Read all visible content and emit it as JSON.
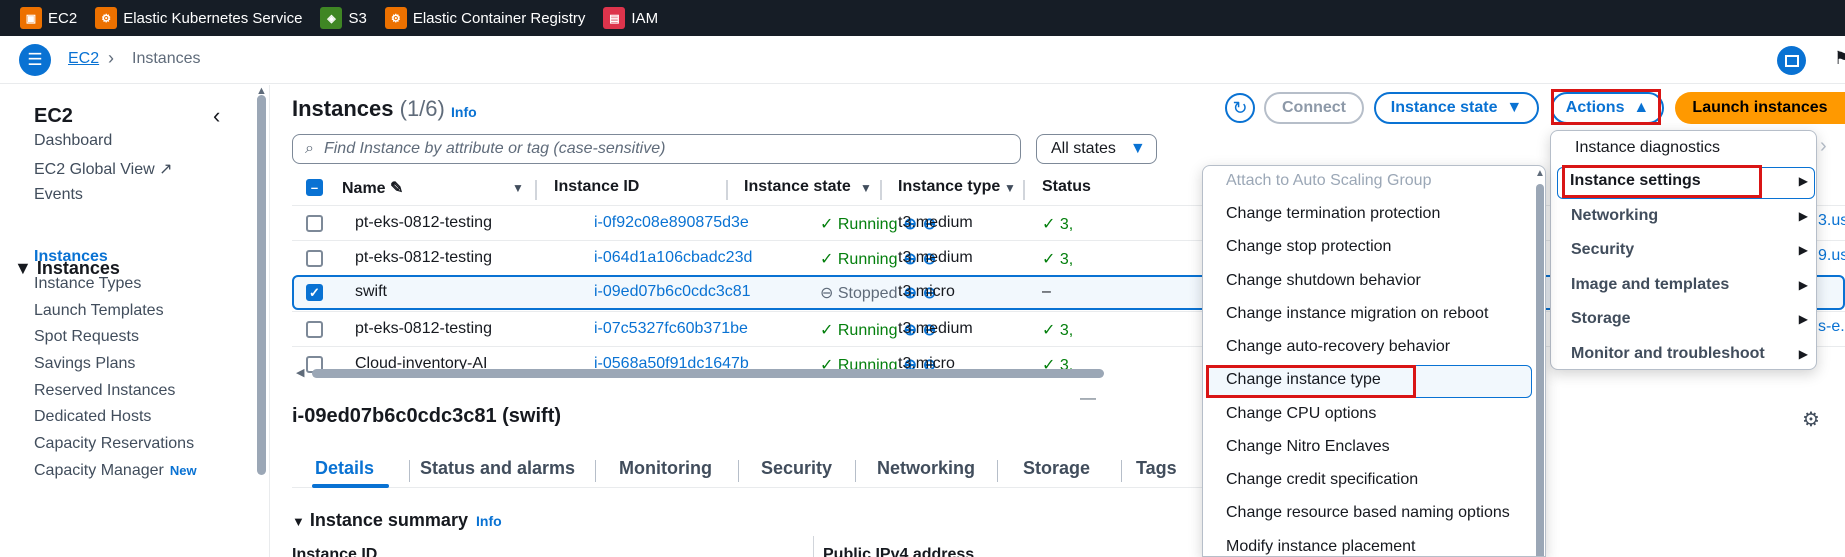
{
  "services": [
    {
      "label": "EC2",
      "icon": "ec2-icon",
      "color": "#ed7100"
    },
    {
      "label": "Elastic Kubernetes Service",
      "icon": "eks-icon",
      "color": "#ed7100"
    },
    {
      "label": "S3",
      "icon": "s3-icon",
      "color": "#3f8624"
    },
    {
      "label": "Elastic Container Registry",
      "icon": "ecr-icon",
      "color": "#ed7100"
    },
    {
      "label": "IAM",
      "icon": "iam-icon",
      "color": "#dd344c"
    }
  ],
  "breadcrumb": {
    "service": "EC2",
    "separator": "›",
    "current": "Instances"
  },
  "sidebar": {
    "title": "EC2",
    "items_top": [
      "Dashboard",
      "EC2 Global View",
      "Events"
    ],
    "group": "Instances",
    "items": [
      "Instances",
      "Instance Types",
      "Launch Templates",
      "Spot Requests",
      "Savings Plans",
      "Reserved Instances",
      "Dedicated Hosts",
      "Capacity Reservations",
      "Capacity Manager"
    ],
    "new_badge": "New"
  },
  "main": {
    "title": "Instances",
    "count": "(1/6)",
    "info": "Info",
    "buttons": {
      "connect": "Connect",
      "instance_state": "Instance state",
      "actions": "Actions",
      "launch": "Launch instances"
    },
    "search_placeholder": "Find Instance by attribute or tag (case-sensitive)",
    "filter": "All states"
  },
  "table": {
    "headers": [
      "Name",
      "Instance ID",
      "Instance state",
      "Instance type",
      "Status"
    ],
    "rows": [
      {
        "name": "pt-eks-0812-testing",
        "id": "i-0f92c08e890875d3e",
        "state": "Running",
        "type": "t3.medium",
        "status": "3,",
        "selected": false
      },
      {
        "name": "pt-eks-0812-testing",
        "id": "i-064d1a106cbadc23d",
        "state": "Running",
        "type": "t3.medium",
        "status": "3,",
        "selected": false
      },
      {
        "name": "swift",
        "id": "i-09ed07b6c0cdc3c81",
        "state": "Stopped",
        "type": "t3.micro",
        "status": "–",
        "selected": true
      },
      {
        "name": "pt-eks-0812-testing",
        "id": "i-07c5327fc60b371be",
        "state": "Running",
        "type": "t3.medium",
        "status": "3,",
        "selected": false
      },
      {
        "name": "Cloud-inventory-AI",
        "id": "i-0568a50f91dc1647b",
        "state": "Running",
        "type": "t3.micro",
        "status": "3,",
        "selected": false
      }
    ]
  },
  "detail": {
    "title": "i-09ed07b6c0cdc3c81 (swift)",
    "tabs": [
      "Details",
      "Status and alarms",
      "Monitoring",
      "Security",
      "Networking",
      "Storage",
      "Tags"
    ],
    "summary_title": "Instance summary",
    "summary_info": "Info",
    "col1": "Instance ID",
    "col2": "Public IPv4 address"
  },
  "actions_menu": [
    "Instance diagnostics",
    "Instance settings",
    "Networking",
    "Security",
    "Image and templates",
    "Storage",
    "Monitor and troubleshoot"
  ],
  "settings_submenu": [
    "Attach to Auto Scaling Group",
    "Change termination protection",
    "Change stop protection",
    "Change shutdown behavior",
    "Change instance migration on reboot",
    "Change auto-recovery behavior",
    "Change instance type",
    "Change CPU options",
    "Change Nitro Enclaves",
    "Change credit specification",
    "Change resource based naming options",
    "Modify instance placement"
  ],
  "right_edge": [
    "3.us",
    "9.us",
    "s-e."
  ]
}
